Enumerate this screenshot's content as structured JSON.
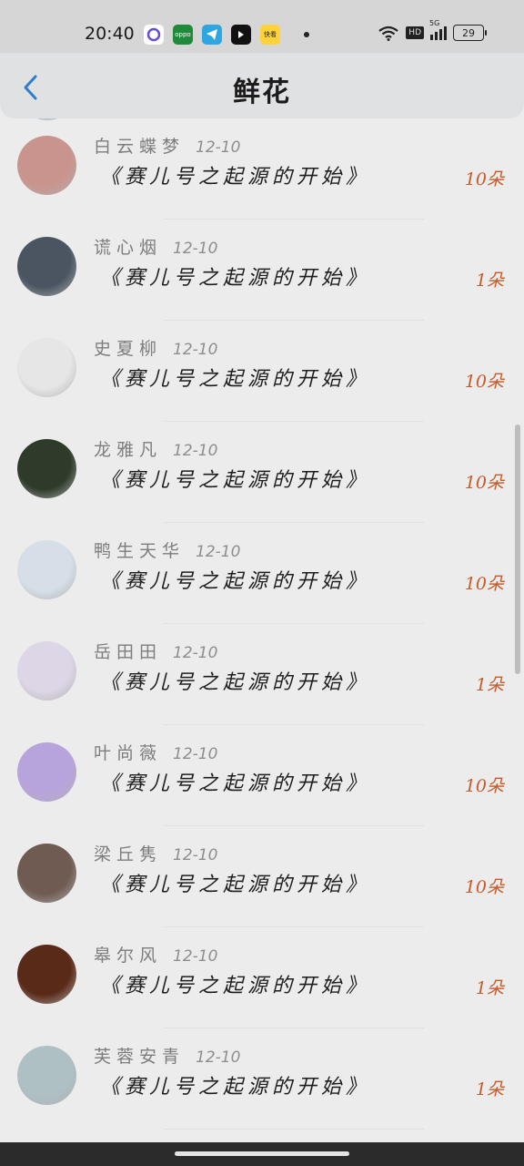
{
  "status_bar": {
    "time": "20:40",
    "app_icons": [
      {
        "name": "circle-app-icon",
        "color": "#ffffff",
        "label": ""
      },
      {
        "name": "oppo-app-icon",
        "color": "#1f8a3a",
        "label": "oppo"
      },
      {
        "name": "telegram-icon",
        "color": "#2ea6df",
        "label": ""
      },
      {
        "name": "dark-app-icon",
        "color": "#111111",
        "label": ""
      },
      {
        "name": "kuaikan-app-icon",
        "color": "#ffd23a",
        "label": "快看"
      }
    ],
    "network": "5G",
    "hd": "HD",
    "battery": "29"
  },
  "header": {
    "title": "鲜花"
  },
  "items": [
    {
      "name": "白云蝶梦",
      "date": "12-10",
      "message": "《赛儿号之起源的开始》",
      "gift": "10朵",
      "avatar_color": "#c9948e"
    },
    {
      "name": "谎心烟",
      "date": "12-10",
      "message": "《赛儿号之起源的开始》",
      "gift": "1朵",
      "avatar_color": "#4b5562"
    },
    {
      "name": "史夏柳",
      "date": "12-10",
      "message": "《赛儿号之起源的开始》",
      "gift": "10朵",
      "avatar_color": "#e6e6e6"
    },
    {
      "name": "龙雅凡",
      "date": "12-10",
      "message": "《赛儿号之起源的开始》",
      "gift": "10朵",
      "avatar_color": "#2e3b2a"
    },
    {
      "name": "鸭生天华",
      "date": "12-10",
      "message": "《赛儿号之起源的开始》",
      "gift": "10朵",
      "avatar_color": "#d6dfe8"
    },
    {
      "name": "岳田田",
      "date": "12-10",
      "message": "《赛儿号之起源的开始》",
      "gift": "1朵",
      "avatar_color": "#ddd6e6"
    },
    {
      "name": "叶尚薇",
      "date": "12-10",
      "message": "《赛儿号之起源的开始》",
      "gift": "10朵",
      "avatar_color": "#b8a4dc"
    },
    {
      "name": "梁丘隽",
      "date": "12-10",
      "message": "《赛儿号之起源的开始》",
      "gift": "10朵",
      "avatar_color": "#6f5b52"
    },
    {
      "name": "皋尔风",
      "date": "12-10",
      "message": "《赛儿号之起源的开始》",
      "gift": "1朵",
      "avatar_color": "#5a2a18"
    },
    {
      "name": "芙蓉安青",
      "date": "12-10",
      "message": "《赛儿号之起源的开始》",
      "gift": "1朵",
      "avatar_color": "#aec0c4"
    }
  ]
}
